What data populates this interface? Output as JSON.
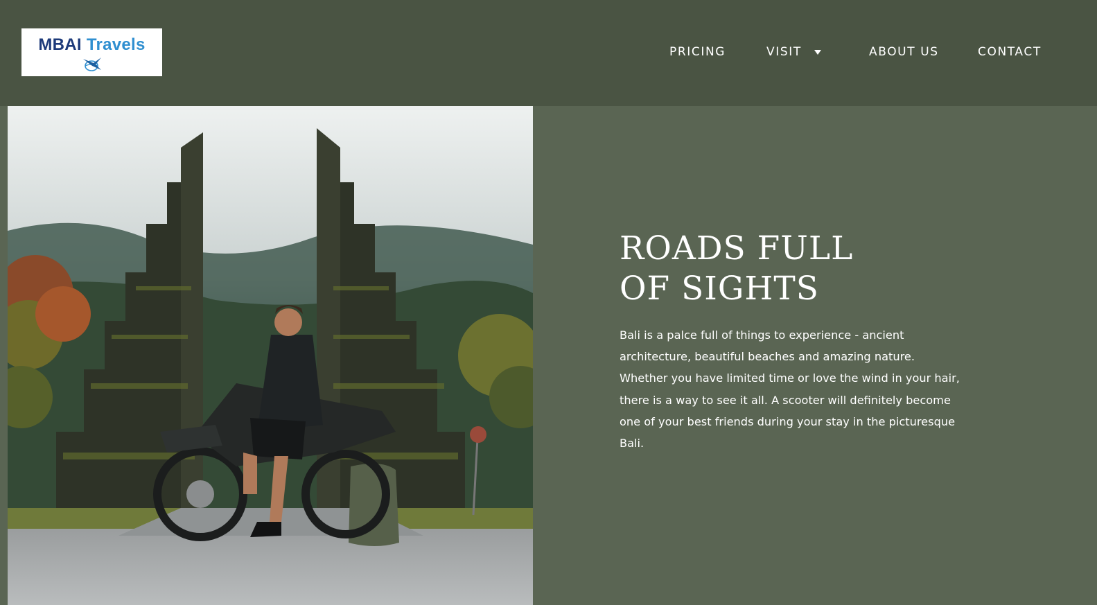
{
  "header": {
    "logo": {
      "word1": "MBAI",
      "word2": "Travels",
      "emblem_icon": "bird-globe-icon",
      "colors": {
        "word1": "#1d3a7a",
        "word2": "#2f8fd0"
      }
    },
    "nav": {
      "pricing": "PRICING",
      "visit": "VISIT",
      "visit_caret_icon": "caret-down-icon",
      "about": "ABOUT US",
      "contact": "CONTACT"
    },
    "background_color": "#4a5443"
  },
  "hero": {
    "image_description_icon": "bali-gate-motorcycle-photo",
    "title_line1": "ROADS FULL",
    "title_line2": "OF SIGHTS",
    "body": "Bali is a palce full of things to experience - ancient architecture, beautiful beaches and amazing nature. Whether you have limited time or love the wind in your hair, there is a way to see it all. A scooter will definitely become one of your best friends during your stay in the picturesque Bali.",
    "background_color": "#5a6553"
  }
}
